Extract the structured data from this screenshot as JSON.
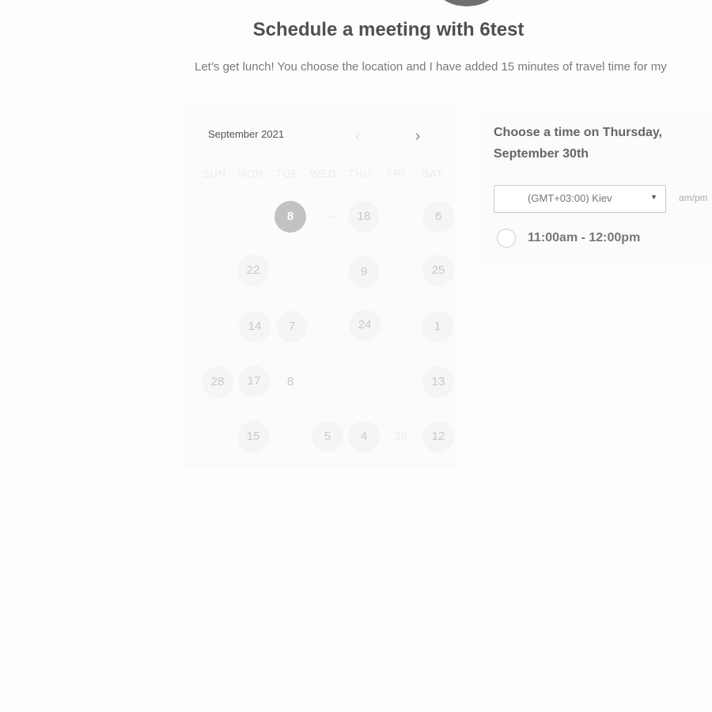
{
  "header": {
    "title": "Schedule a meeting with 6test",
    "description": "Let’s get lunch! You choose the location and I have added 15 minutes of travel time for my"
  },
  "calendar": {
    "month_label": "September 2021",
    "prev_icon": "chevron-left-icon",
    "next_icon": "chevron-right-icon",
    "prev_glyph": "‹",
    "next_glyph": "›",
    "weekdays": [
      "SUN",
      "MON",
      "TUE",
      "WED",
      "THU",
      "FRI",
      "SAT"
    ],
    "selected_day": "8",
    "days": [
      {
        "label": "8",
        "state": "selected"
      },
      {
        "label": "–",
        "state": "faint"
      },
      {
        "label": "18",
        "state": "available"
      },
      {
        "label": "6",
        "state": "available"
      },
      {
        "label": "22",
        "state": "available"
      },
      {
        "label": "·",
        "state": "faint"
      },
      {
        "label": "9",
        "state": "available"
      },
      {
        "label": "25",
        "state": "available"
      },
      {
        "label": "14",
        "state": "available"
      },
      {
        "label": "7",
        "state": "available"
      },
      {
        "label": "24",
        "state": "available"
      },
      {
        "label": "1",
        "state": "available"
      },
      {
        "label": "28",
        "state": "available"
      },
      {
        "label": "17",
        "state": "available"
      },
      {
        "label": "8",
        "state": "bare"
      },
      {
        "label": "13",
        "state": "available"
      },
      {
        "label": "15",
        "state": "available"
      },
      {
        "label": "5",
        "state": "available"
      },
      {
        "label": "4",
        "state": "available"
      },
      {
        "label": "28",
        "state": "faint"
      },
      {
        "label": "12",
        "state": "available"
      }
    ]
  },
  "time_panel": {
    "heading": "Choose a time on Thursday, September 30th",
    "timezone": "(GMT+03:00) Kiev",
    "timezone_caret_icon": "caret-down-icon",
    "time_format": "am/pm",
    "slots": [
      {
        "label": "11:00am - 12:00pm"
      }
    ]
  },
  "colors": {
    "selected_day": "#c2c2c2",
    "available_day_bg": "#f5f5f5",
    "avatar": "#6f6f6f"
  }
}
